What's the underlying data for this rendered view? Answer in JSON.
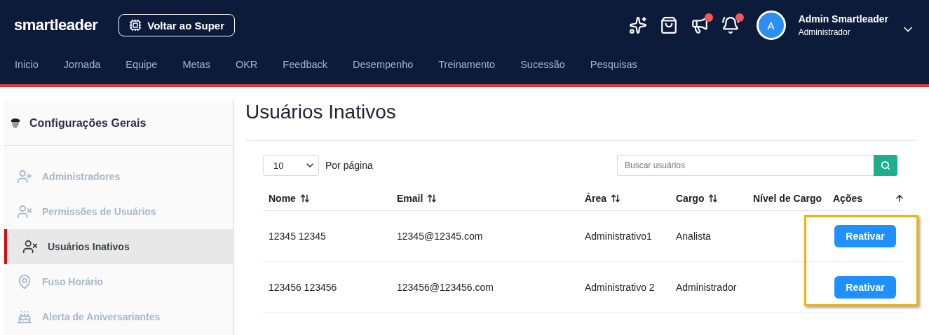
{
  "header": {
    "logo": "smartleader",
    "back_button": "Voltar ao Super",
    "icons": [
      {
        "kind": "sparkles",
        "badge": false
      },
      {
        "kind": "bag",
        "badge": false
      },
      {
        "kind": "megaphone",
        "badge": true
      },
      {
        "kind": "bell",
        "badge": true
      }
    ],
    "user": {
      "initial": "A",
      "name": "Admin Smartleader",
      "role": "Administrador"
    }
  },
  "nav": [
    {
      "label": "Inicio"
    },
    {
      "label": "Jornada"
    },
    {
      "label": "Equipe"
    },
    {
      "label": "Metas"
    },
    {
      "label": "OKR"
    },
    {
      "label": "Feedback"
    },
    {
      "label": "Desempenho"
    },
    {
      "label": "Treinamento"
    },
    {
      "label": "Sucessão"
    },
    {
      "label": "Pesquisas"
    }
  ],
  "sidebar": {
    "title": "Configurações Gerais",
    "items": [
      {
        "label": "Administradores",
        "selected": false
      },
      {
        "label": "Permissões de Usuários",
        "selected": false
      },
      {
        "label": "Usuários Inativos",
        "selected": true
      },
      {
        "label": "Fuso Horário",
        "selected": false
      },
      {
        "label": "Alerta de Aniversariantes",
        "selected": false
      }
    ]
  },
  "page": {
    "title": "Usuários Inativos",
    "page_size": "10",
    "page_size_label": "Por página",
    "search": {
      "placeholder": "Buscar usuários"
    },
    "table": {
      "columns": [
        {
          "label": "Nome",
          "sortable": true
        },
        {
          "label": "Email",
          "sortable": true
        },
        {
          "label": "Área",
          "sortable": true
        },
        {
          "label": "Cargo",
          "sortable": true
        },
        {
          "label": "Nível de Cargo",
          "sortable": false
        },
        {
          "label": "Ações",
          "sortable": false
        }
      ],
      "rows": [
        {
          "name": "12345 12345",
          "email": "12345@12345.com",
          "area": "Administrativo1",
          "cargo": "Analista",
          "action": "Reativar"
        },
        {
          "name": "123456 123456",
          "email": "123456@123456.com",
          "area": "Administrativo 2",
          "cargo": "Administrador",
          "action": "Reativar"
        }
      ]
    }
  }
}
